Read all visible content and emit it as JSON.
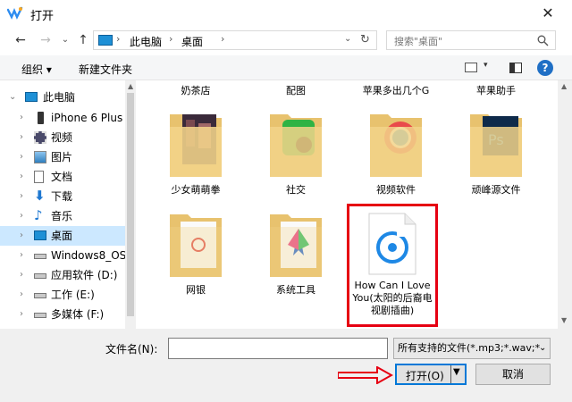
{
  "window": {
    "title": "打开",
    "close": "✕"
  },
  "address": {
    "path_root": "此电脑",
    "path_current": "桌面",
    "separator": "›"
  },
  "search": {
    "placeholder": "搜索\"桌面\""
  },
  "toolbar": {
    "organize": "组织 ▾",
    "new_folder": "新建文件夹"
  },
  "nav": {
    "items": [
      {
        "label": "此电脑",
        "icon": "computer-icon",
        "expanded": true
      },
      {
        "label": "iPhone 6 Plus",
        "icon": "phone-icon"
      },
      {
        "label": "视频",
        "icon": "video-icon"
      },
      {
        "label": "图片",
        "icon": "picture-icon"
      },
      {
        "label": "文档",
        "icon": "document-icon"
      },
      {
        "label": "下载",
        "icon": "download-icon"
      },
      {
        "label": "音乐",
        "icon": "music-icon"
      },
      {
        "label": "桌面",
        "icon": "desktop-icon",
        "selected": true
      },
      {
        "label": "Windows8_OS",
        "icon": "drive-icon"
      },
      {
        "label": "应用软件 (D:)",
        "icon": "drive-icon"
      },
      {
        "label": "工作 (E:)",
        "icon": "drive-icon"
      },
      {
        "label": "多媒体 (F:)",
        "icon": "drive-icon"
      }
    ]
  },
  "content": {
    "top_labels": [
      "奶茶店",
      "配图",
      "苹果多出几个G",
      "苹果助手"
    ],
    "items": [
      {
        "label": "少女萌萌拳",
        "type": "folder"
      },
      {
        "label": "社交",
        "type": "folder"
      },
      {
        "label": "视频软件",
        "type": "folder"
      },
      {
        "label": "顽峰源文件",
        "type": "folder"
      },
      {
        "label": "网银",
        "type": "folder"
      },
      {
        "label": "系统工具",
        "type": "folder"
      },
      {
        "label": "How Can I Love You(太阳的后裔电视剧插曲)",
        "type": "music-file",
        "highlighted": true
      }
    ]
  },
  "footer": {
    "filename_label": "文件名(N):",
    "filename_value": "",
    "filetype": "所有支持的文件(*.mp3;*.wav;*",
    "open_label": "打开(O)",
    "cancel_label": "取消"
  },
  "colors": {
    "accent": "#0078d7",
    "highlight_border": "#e60012",
    "selected_nav": "#cce8ff",
    "arrow": "#e60012"
  }
}
